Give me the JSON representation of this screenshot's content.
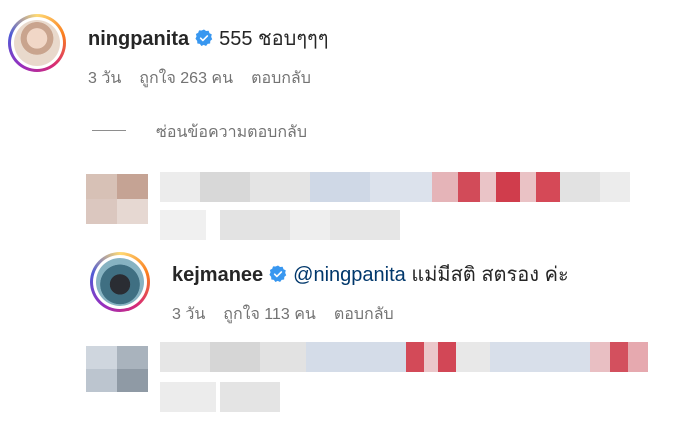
{
  "comments": [
    {
      "username": "ningpanita",
      "text": "555 ชอบๆๆๆ",
      "time": "3 วัน",
      "likes": "ถูกใจ 263 คน",
      "reply": "ตอบกลับ"
    },
    {
      "username": "kejmanee",
      "mention": "@ningpanita",
      "text": "แม่มีสติ สตรอง ค่ะ",
      "time": "3 วัน",
      "likes": "ถูกใจ 113 คน",
      "reply": "ตอบกลับ"
    }
  ],
  "hide_replies_label": "ซ่อนข้อความตอบกลับ",
  "colors": {
    "verified": "#3897f0",
    "mention": "#00376b",
    "meta": "#737373"
  },
  "icons": [
    "verified-badge-icon"
  ],
  "censored": "pixelated comments"
}
